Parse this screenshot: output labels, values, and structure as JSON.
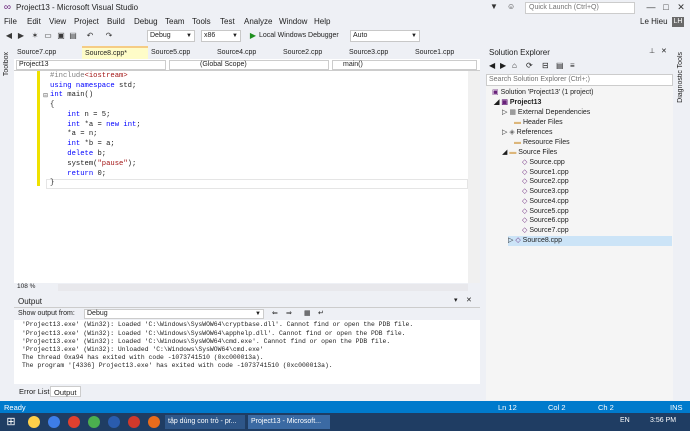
{
  "window": {
    "title": "Project13 - Microsoft Visual Studio",
    "user": "Le Hieu",
    "quick_launch": "Quick Launch (Ctrl+Q)"
  },
  "menu": [
    "File",
    "Edit",
    "View",
    "Project",
    "Build",
    "Debug",
    "Team",
    "Tools",
    "Test",
    "Analyze",
    "Window",
    "Help"
  ],
  "toolbar": {
    "config": "Debug",
    "platform": "x86",
    "run_label": "Local Windows Debugger",
    "run_mode": "Auto"
  },
  "tabs": [
    "Source7.cpp",
    "Source8.cpp*",
    "Source5.cpp",
    "Source4.cpp",
    "Source2.cpp",
    "Source3.cpp",
    "Source1.cpp"
  ],
  "navbar": {
    "project": "Project13",
    "scope": "(Global Scope)",
    "member": "main()"
  },
  "code": [
    "#include<iostream>",
    "using namespace std;",
    "int main()",
    "{",
    "    int n = 5;",
    "    int *a = new int;",
    "    *a = n;",
    "    int *b = a;",
    "    delete b;",
    "    system(\"pause\");",
    "    return 0;",
    "}"
  ],
  "zoom": "108 %",
  "output": {
    "title": "Output",
    "show_from_label": "Show output from:",
    "source": "Debug",
    "lines": [
      "'Project13.exe' (Win32): Loaded 'C:\\Windows\\SysWOW64\\cryptbase.dll'. Cannot find or open the PDB file.",
      "'Project13.exe' (Win32): Loaded 'C:\\Windows\\SysWOW64\\apphelp.dll'. Cannot find or open the PDB file.",
      "'Project13.exe' (Win32): Loaded 'C:\\Windows\\SysWOW64\\cmd.exe'. Cannot find or open the PDB file.",
      "'Project13.exe' (Win32): Unloaded 'C:\\Windows\\SysWOW64\\cmd.exe'",
      "The thread 0xa94 has exited with code -1073741510 (0xc000013a).",
      "The program '[4336] Project13.exe' has exited with code -1073741510 (0xc000013a)."
    ]
  },
  "bottom_tabs": [
    "Error List",
    "Output"
  ],
  "solution_explorer": {
    "title": "Solution Explorer",
    "search": "Search Solution Explorer (Ctrl+;)",
    "solution": "Solution 'Project13' (1 project)",
    "project": "Project13",
    "folders": [
      "External Dependencies",
      "Header Files",
      "References",
      "Resource Files",
      "Source Files"
    ],
    "files": [
      "Source.cpp",
      "Source1.cpp",
      "Source2.cpp",
      "Source3.cpp",
      "Source4.cpp",
      "Source5.cpp",
      "Source6.cpp",
      "Source7.cpp",
      "Source8.cpp"
    ]
  },
  "side_labels": {
    "left": "Toolbox",
    "right": "Diagnostic Tools"
  },
  "status": {
    "state": "Ready",
    "line": "Ln 12",
    "col": "Col 2",
    "ch": "Ch 2",
    "mode": "INS"
  },
  "taskbar": {
    "item1": "tập dùng con trỏ - pr...",
    "item2": "Project13 - Microsoft...",
    "lang": "EN",
    "time": "3:56 PM"
  }
}
